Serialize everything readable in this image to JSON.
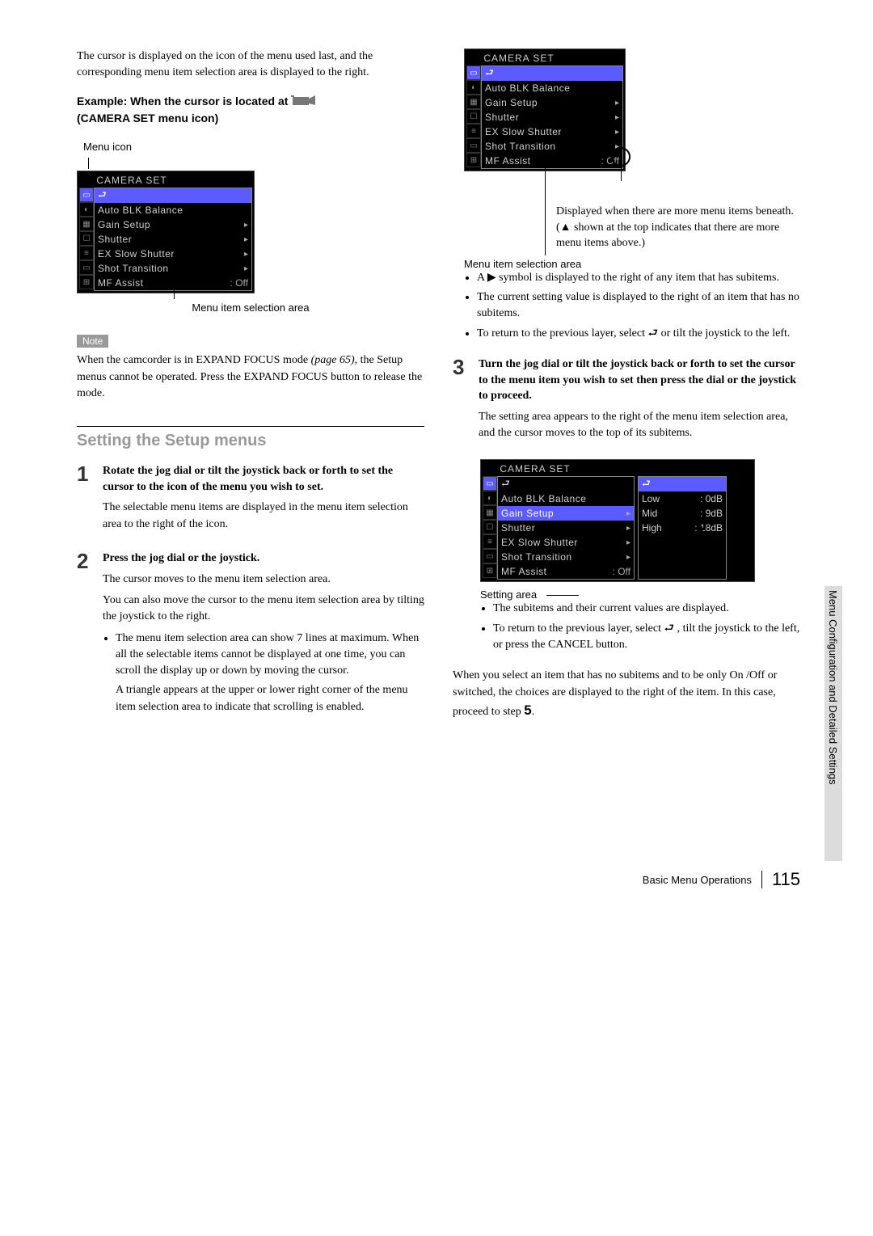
{
  "intro": "The cursor is displayed on the icon of the menu used last, and the corresponding menu item selection area is displayed to the right.",
  "example_heading_line1": "Example: When the cursor is located at",
  "example_heading_line2": "(CAMERA SET menu icon)",
  "menu_icon_label": "Menu icon",
  "menu": {
    "title": "CAMERA SET",
    "items": [
      {
        "label": "⮐",
        "arrow": "",
        "value": ""
      },
      {
        "label": "Auto BLK Balance",
        "arrow": "",
        "value": ""
      },
      {
        "label": "Gain Setup",
        "arrow": "▸",
        "value": ""
      },
      {
        "label": "Shutter",
        "arrow": "▸",
        "value": ""
      },
      {
        "label": "EX Slow Shutter",
        "arrow": "▸",
        "value": ""
      },
      {
        "label": "Shot Transition",
        "arrow": "▸",
        "value": ""
      },
      {
        "label": "MF Assist",
        "arrow": "",
        "value": ": Off"
      }
    ]
  },
  "selection_label": "Menu item selection area",
  "note_badge": "Note",
  "note_text_a": "When the camcorder is in EXPAND FOCUS mode ",
  "note_text_page": "(page 65)",
  "note_text_b": ", the Setup menus cannot be operated. Press the EXPAND FOCUS button to release the mode.",
  "section_heading": "Setting the Setup menus",
  "step1": {
    "num": "1",
    "title": "Rotate the jog dial or tilt the joystick back or forth to set the cursor to the icon of the menu you wish to set.",
    "desc": "The selectable menu items are displayed in the menu item selection area to the right of the icon."
  },
  "step2": {
    "num": "2",
    "title": "Press the jog dial or the joystick.",
    "desc1": "The cursor moves to the menu item selection area.",
    "desc2": "You can also move the cursor to the menu item selection area by tilting the joystick to the right.",
    "bullet": "The menu item selection area can show 7 lines at maximum. When all the selectable items cannot be displayed at one time, you can scroll the display up or down by moving the cursor.",
    "sub": "A triangle appears at the upper or lower right corner of the menu item selection area to indicate that scrolling is enabled."
  },
  "scroll_note": "Displayed when there are more menu items beneath. (▲ shown at the top indicates that there are more menu items above.)",
  "mi_sel_label": "Menu item selection area",
  "mi_bullets": [
    "A ▶ symbol is displayed to the right of any item that has subitems.",
    "The current setting value is displayed to the right of an item that has no subitems.",
    "To return to the previous layer, select ⮐ or tilt the joystick to the left."
  ],
  "step3": {
    "num": "3",
    "title": "Turn the jog dial or tilt the joystick back or forth to set the cursor to the menu item you wish to set then press the dial or the joystick to proceed.",
    "desc": "The setting area appears to the right of the menu item selection area, and the cursor moves to the top of its subitems."
  },
  "settings": {
    "rows": [
      {
        "label": "⮐",
        "value": ""
      },
      {
        "label": "Low",
        "value": ": 0dB"
      },
      {
        "label": "Mid",
        "value": ": 9dB"
      },
      {
        "label": "High",
        "value": ": 18dB"
      }
    ]
  },
  "setting_area_label": "Setting area",
  "setting_bullets": [
    "The subitems and their current values are displayed.",
    "To return to the previous layer, select ⮐ , tilt the joystick to the left, or press the CANCEL button."
  ],
  "closing": "When you select an item that has no subitems and to be only On /Off or switched, the choices are displayed to the right of the item. In this case, proceed to step ",
  "closing_step": "5",
  "closing_end": ".",
  "side_tab": "Menu Configuration and Detailed Settings",
  "footer_title": "Basic Menu Operations",
  "page_number": "115"
}
